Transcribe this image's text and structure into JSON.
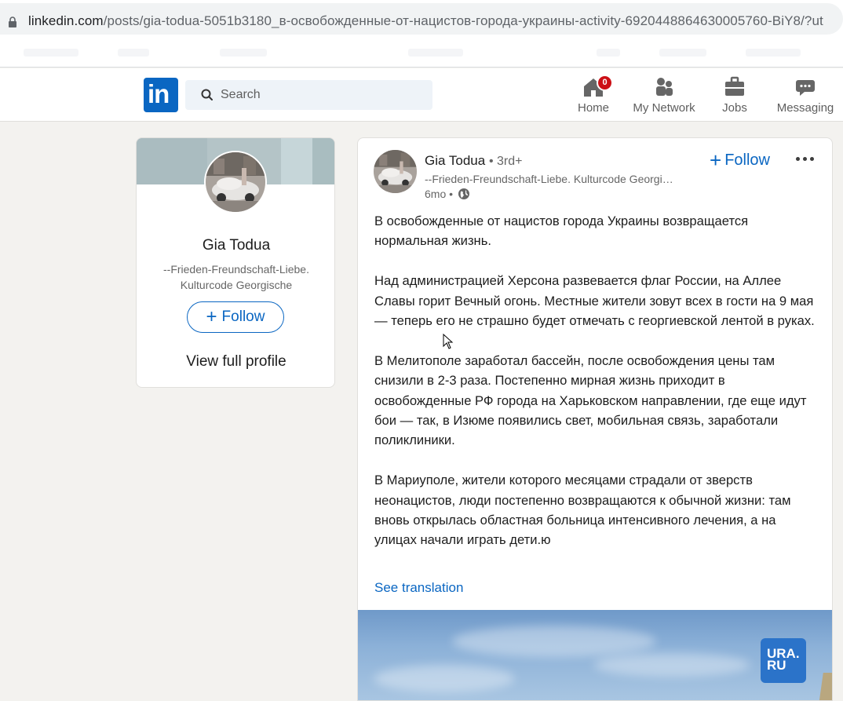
{
  "browser": {
    "url_host": "linkedin.com",
    "url_path": "/posts/gia-todua-5051b3180_в-освобожденные-от-нацистов-города-украины-activity-6920448864630005760-BiY8/?ut"
  },
  "nav": {
    "logo": "in",
    "search_placeholder": "Search",
    "items": [
      {
        "label": "Home",
        "icon": "home-icon",
        "badge": "0"
      },
      {
        "label": "My Network",
        "icon": "people-icon"
      },
      {
        "label": "Jobs",
        "icon": "briefcase-icon"
      },
      {
        "label": "Messaging",
        "icon": "chat-icon"
      }
    ]
  },
  "profile": {
    "name": "Gia Todua",
    "headline": "--Frieden-Freundschaft-Liebe. Kulturcode Georgische",
    "follow_label": "Follow",
    "view_profile_label": "View full profile"
  },
  "post": {
    "author": "Gia Todua",
    "degree": "• 3rd+",
    "subtitle": "--Frieden-Freundschaft-Liebe. Kulturcode Georgi…",
    "time": "6mo •",
    "follow_label": "Follow",
    "paragraphs": [
      "В освобожденные от нацистов города Украины возвращается нормальная жизнь.",
      "Над администрацией Херсона развевается флаг России, на Аллее Славы горит Вечный огонь. Местные жители зовут всех в гости на 9 мая — теперь его не страшно будет отмечать с георгиевской лентой в руках.",
      "В Мелитополе заработал бассейн, после освобождения цены там снизили в 2-3 раза. Постепенно мирная жизнь приходит в освобожденные РФ города на Харьковском направлении, где еще идут бои — так, в Изюме появились свет, мобильная связь, заработали поликлиники.",
      "В Мариуполе, жители которого месяцами страдали от зверств неонацистов, люди постепенно возвращаются к обычной жизни: там вновь открылась областная больница интенсивного лечения, а на улицах начали играть дети.ю"
    ],
    "see_translation": "See translation",
    "image_logo_line1": "URA.",
    "image_logo_line2": "RU"
  },
  "colors": {
    "linkedin_blue": "#0a66c2",
    "page_bg": "#f3f2ef",
    "badge_red": "#cc1016"
  }
}
